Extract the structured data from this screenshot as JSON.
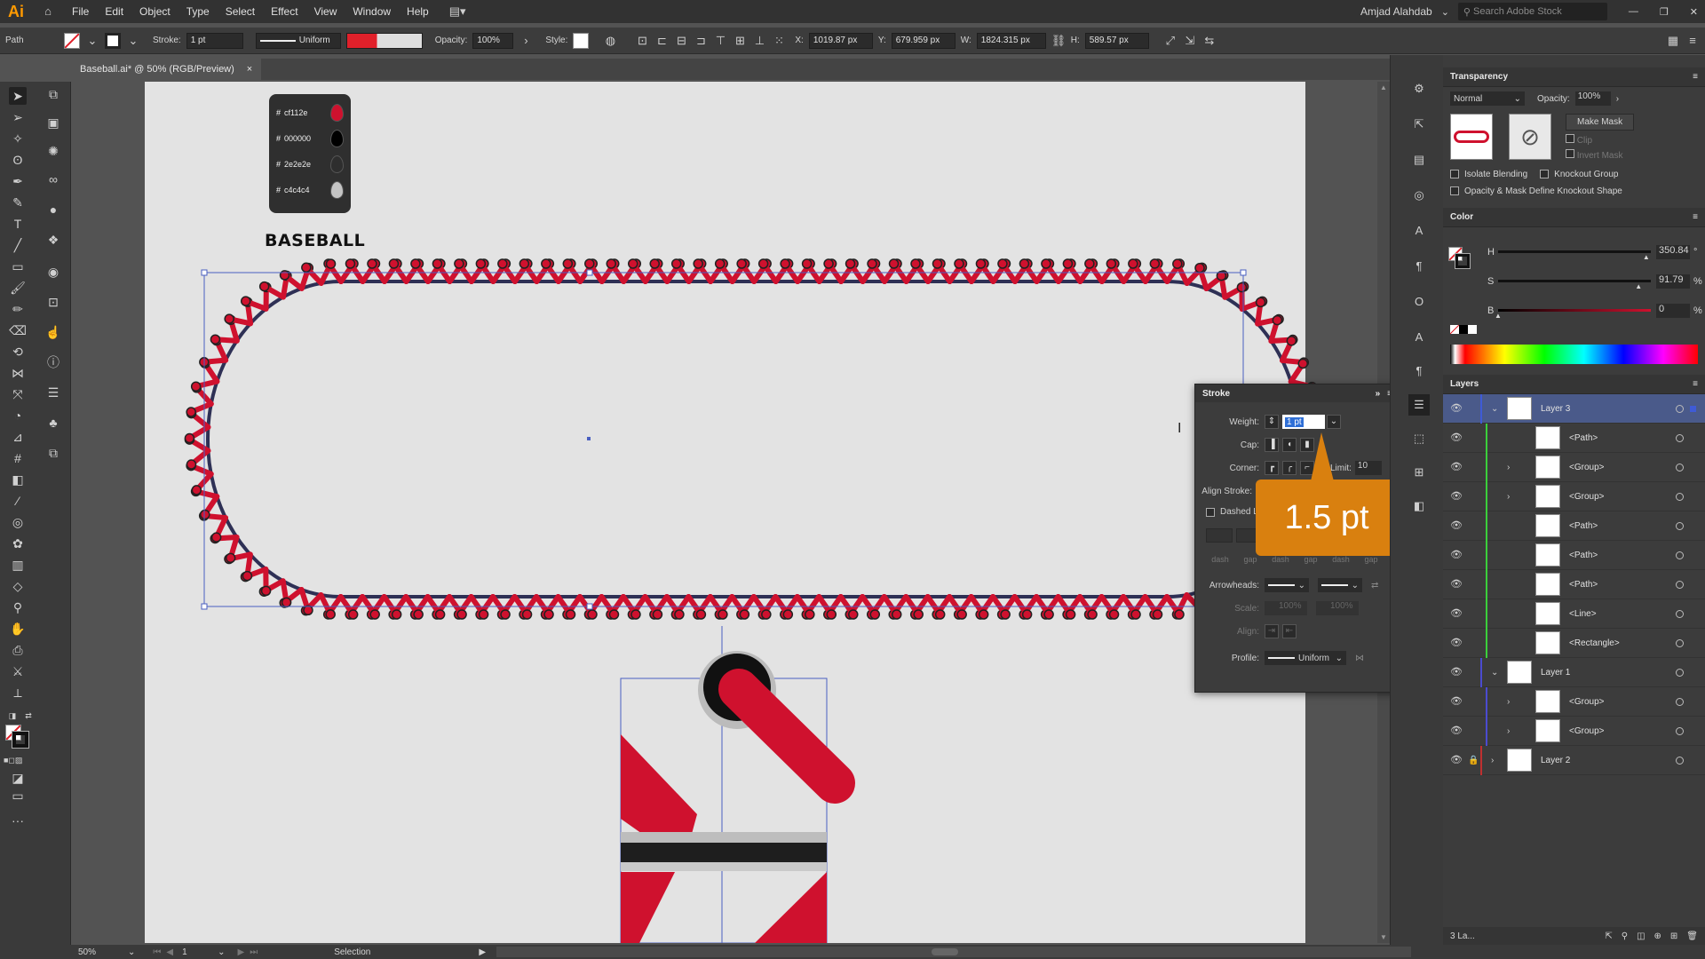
{
  "app": {
    "logo": "Ai",
    "user": "Amjad Alahdab",
    "search_placeholder": "Search Adobe Stock"
  },
  "menu": [
    "File",
    "Edit",
    "Object",
    "Type",
    "Select",
    "Effect",
    "View",
    "Window",
    "Help"
  ],
  "control": {
    "selection_type": "Path",
    "stroke_label": "Stroke:",
    "stroke_value": "1 pt",
    "profile": "Uniform",
    "opacity_label": "Opacity:",
    "opacity_value": "100%",
    "style_label": "Style:",
    "x_label": "X:",
    "x_value": "1019.87 px",
    "y_label": "Y:",
    "y_value": "679.959 px",
    "w_label": "W:",
    "w_value": "1824.315 px",
    "h_label": "H:",
    "h_value": "589.57 px"
  },
  "document": {
    "tab_title": "Baseball.ai* @ 50% (RGB/Preview)",
    "close": "×"
  },
  "artboard": {
    "title": "BASEBALL",
    "swatches": [
      {
        "hex": "cf112e",
        "color": "#cf112e"
      },
      {
        "hex": "000000",
        "color": "#000000"
      },
      {
        "hex": "2e2e2e",
        "color": "#2e2e2e"
      },
      {
        "hex": "c4c4c4",
        "color": "#c4c4c4"
      }
    ],
    "colors": {
      "stitch": "#cf112e",
      "seam": "#2e3055",
      "selection": "#4a5fc1"
    }
  },
  "stroke_panel": {
    "title": "Stroke",
    "weight_label": "Weight:",
    "weight_value": "1 pt",
    "cap_label": "Cap:",
    "corner_label": "Corner:",
    "limit_label": "Limit:",
    "limit_value": "10",
    "align_label": "Align Stroke:",
    "dashed_label": "Dashed Line",
    "dash_labels": [
      "dash",
      "gap",
      "dash",
      "gap",
      "dash",
      "gap"
    ],
    "arrowheads_label": "Arrowheads:",
    "scale_label": "Scale:",
    "scale_values": [
      "100%",
      "100%"
    ],
    "align2_label": "Align:",
    "profile_label": "Profile:",
    "profile_value": "Uniform"
  },
  "callout": {
    "text": "1.5 pt"
  },
  "transparency": {
    "title": "Transparency",
    "mode": "Normal",
    "opacity_label": "Opacity:",
    "opacity_value": "100%",
    "make_mask": "Make Mask",
    "clip": "Clip",
    "invert": "Invert Mask",
    "isolate": "Isolate Blending",
    "knockout": "Knockout Group",
    "opacity_mask": "Opacity & Mask Define Knockout Shape"
  },
  "color_panel": {
    "title": "Color",
    "channels": [
      {
        "label": "H",
        "value": "350.84",
        "unit": "°",
        "level": 0.97
      },
      {
        "label": "S",
        "value": "91.79",
        "unit": "%",
        "level": 0.92
      },
      {
        "label": "B",
        "value": "0",
        "unit": "%",
        "level": 0.0
      }
    ]
  },
  "layers": {
    "title": "Layers",
    "rows": [
      {
        "name": "Layer 3",
        "indent": 0,
        "expanded": true,
        "selected": true,
        "bar": "#3f5bd6"
      },
      {
        "name": "<Path>",
        "indent": 1,
        "bar": "#3bcf3b"
      },
      {
        "name": "<Group>",
        "indent": 1,
        "expandable": true,
        "bar": "#3bcf3b"
      },
      {
        "name": "<Group>",
        "indent": 1,
        "expandable": true,
        "bar": "#3bcf3b"
      },
      {
        "name": "<Path>",
        "indent": 1,
        "bar": "#3bcf3b"
      },
      {
        "name": "<Path>",
        "indent": 1,
        "bar": "#3bcf3b"
      },
      {
        "name": "<Path>",
        "indent": 1,
        "bar": "#3bcf3b"
      },
      {
        "name": "<Line>",
        "indent": 1,
        "bar": "#3bcf3b"
      },
      {
        "name": "<Rectangle>",
        "indent": 1,
        "bar": "#3bcf3b"
      },
      {
        "name": "Layer 1",
        "indent": 0,
        "expanded": true,
        "bar": "#4b4bd0"
      },
      {
        "name": "<Group>",
        "indent": 1,
        "expandable": true,
        "bar": "#4b4bd0"
      },
      {
        "name": "<Group>",
        "indent": 1,
        "expandable": true,
        "bar": "#4b4bd0"
      },
      {
        "name": "Layer 2",
        "indent": 0,
        "locked": true,
        "expandable": true,
        "bar": "#c03030"
      }
    ],
    "footer": "3 La..."
  },
  "status": {
    "zoom": "50%",
    "page": "1",
    "tool": "Selection"
  }
}
